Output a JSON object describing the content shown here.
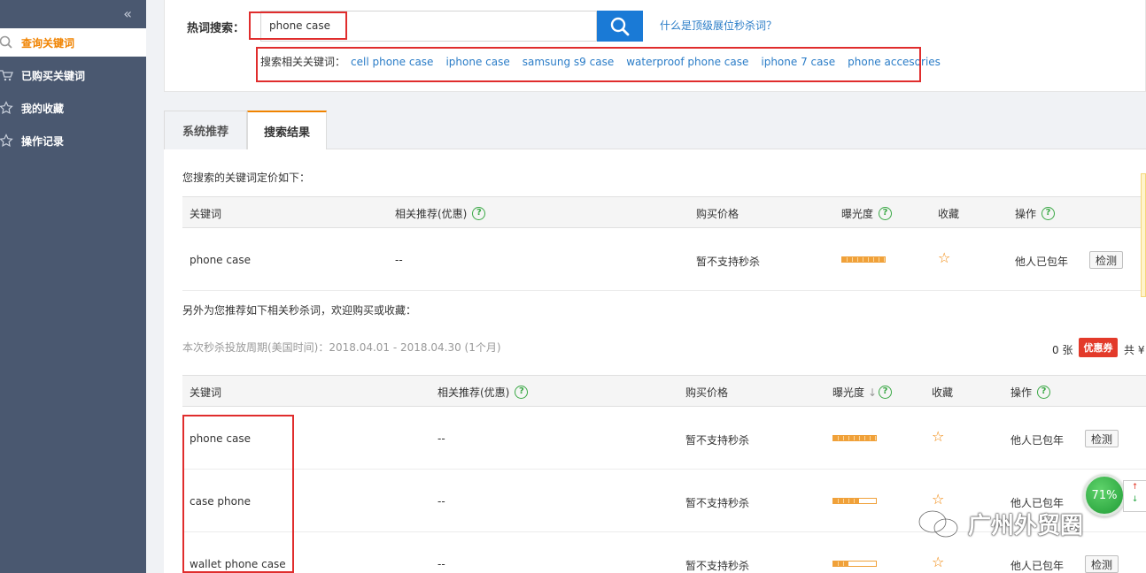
{
  "sidebar": {
    "collapse_icon": "double-chevron-left-icon",
    "items": [
      {
        "label": "查询关键词",
        "icon": "search-icon",
        "active": true
      },
      {
        "label": "已购买关键词",
        "icon": "cart-icon",
        "active": false
      },
      {
        "label": "我的收藏",
        "icon": "star-icon",
        "active": false
      },
      {
        "label": "操作记录",
        "icon": "star-icon",
        "active": false
      }
    ]
  },
  "search": {
    "label": "热词搜索：",
    "value": "phone case",
    "help_link": "什么是顶级展位秒杀词？",
    "related_label": "搜索相关关键词：",
    "related": [
      "cell phone case",
      "iphone case",
      "samsung s9 case",
      "waterproof phone case",
      "iphone 7 case",
      "phone accesories"
    ]
  },
  "tabs": [
    {
      "label": "系统推荐",
      "active": false
    },
    {
      "label": "搜索结果",
      "active": true
    }
  ],
  "pricing": {
    "intro": "您搜索的关键词定价如下：",
    "headers": [
      "关键词",
      "相关推荐(优惠)",
      "购买价格",
      "曝光度",
      "收藏",
      "操作"
    ],
    "rows": [
      {
        "keyword": "phone case",
        "related": "--",
        "price": "暂不支持秒杀",
        "exposure": 1.0,
        "status": "他人已包年",
        "action": "检测"
      }
    ]
  },
  "recommend": {
    "intro": "另外为您推荐如下相关秒杀词，欢迎购买或收藏：",
    "period": "本次秒杀投放周期(美国时间)：2018.04.01 - 2018.04.30 (1个月)",
    "coupon_count": "0 张",
    "coupon_label": "优惠券",
    "total_label": "共 ¥",
    "headers": [
      "关键词",
      "相关推荐(优惠)",
      "购买价格",
      "曝光度",
      "收藏",
      "操作"
    ],
    "rows": [
      {
        "keyword": "phone case",
        "related": "--",
        "price": "暂不支持秒杀",
        "exposure": 1.0,
        "status": "他人已包年",
        "action": "检测"
      },
      {
        "keyword": "case phone",
        "related": "--",
        "price": "暂不支持秒杀",
        "exposure": 0.6,
        "status": "他人已包年",
        "action": ""
      },
      {
        "keyword": "wallet phone case",
        "related": "--",
        "price": "暂不支持秒杀",
        "exposure": 0.35,
        "status": "他人已包年",
        "action": "检测"
      }
    ]
  },
  "widget": {
    "percent": "71%"
  },
  "watermark": "广州外贸圈",
  "colors": {
    "accent": "#f08300",
    "link": "#2a7cc7",
    "sidebar": "#4a5870",
    "search_button": "#1a7ad6",
    "highlight": "#e02d2d"
  }
}
